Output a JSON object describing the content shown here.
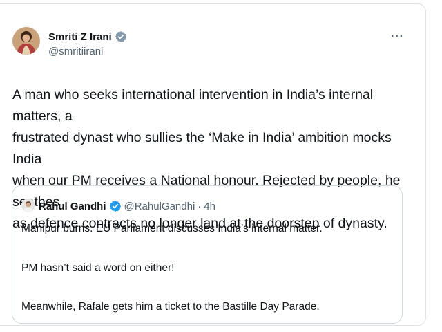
{
  "tweet": {
    "author_name": "Smriti Z Irani",
    "author_handle": "@smritiirani",
    "more_label": "···",
    "text_lines": [
      "A man who seeks international intervention in India’s internal matters, a",
      "frustrated dynast who sullies the ‘Make in India’ ambition mocks India",
      "when our PM receives a National honour. Rejected by people, he seethes",
      "as defence contracts no longer land at the doorstep of dynasty."
    ]
  },
  "quote": {
    "author_name": "Rahul Gandhi",
    "author_handle": "@RahulGandhi",
    "separator": "·",
    "time": "4h",
    "lines": [
      "Manipur burns. EU Parliament discusses India’s internal matter.",
      "PM hasn’t said a word on either!",
      "Meanwhile, Rafale gets him a ticket to the Bastille Day Parade."
    ]
  },
  "colors": {
    "verified_gray": "#829aab",
    "verified_blue": "#1d9bf0",
    "border": "#cfd9de",
    "secondary_text": "#536471"
  },
  "icons": {
    "main_verified": "verified-badge-icon",
    "quote_verified": "verified-badge-icon",
    "more": "more-options-icon"
  }
}
